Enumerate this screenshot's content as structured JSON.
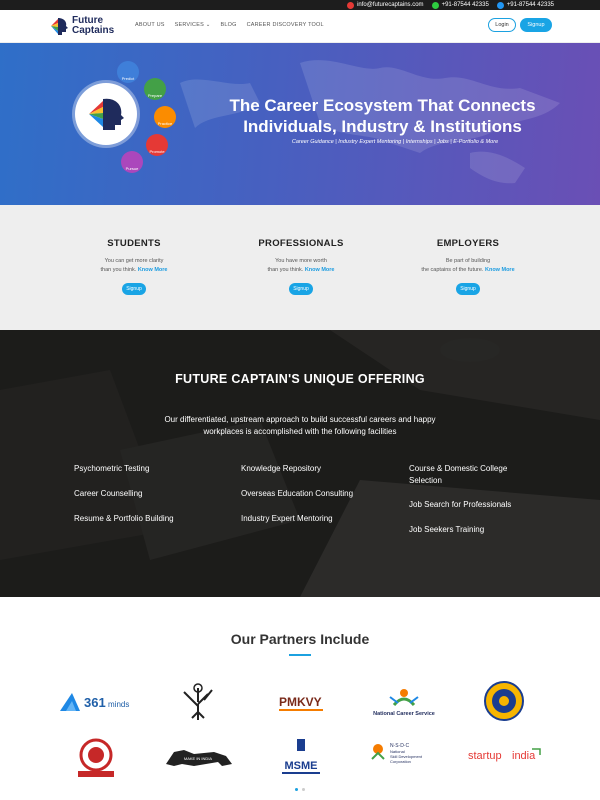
{
  "topbar": {
    "email": "info@futurecaptains.com",
    "whatsapp": "+91-87544 42335",
    "phone": "+91-87544 42335"
  },
  "brand": {
    "name_line1": "Future",
    "name_line2": "Captains"
  },
  "nav": {
    "items": [
      "ABOUT US",
      "SERVICES",
      "BLOG",
      "CAREER DISCOVERY TOOL"
    ],
    "login": "Login",
    "signup": "Signup"
  },
  "hero": {
    "title_line1": "The Career Ecosystem That Connects",
    "title_line2": "Individuals, Industry & Institutions",
    "subtitle": "Career Guidance | Industry Expert Mentoring | Internships | Jobs | E-Portfolio & More",
    "bubbles": [
      "Predict",
      "Prepare",
      "Practice",
      "Promote",
      "Pursue"
    ]
  },
  "audience": [
    {
      "title": "STUDENTS",
      "line1": "You can get more clarity",
      "line2": "than you think.",
      "link": "Know More",
      "button": "Signup"
    },
    {
      "title": "PROFESSIONALS",
      "line1": "You have more worth",
      "line2": "than you think.",
      "link": "Know More",
      "button": "Signup"
    },
    {
      "title": "EMPLOYERS",
      "line1": "Be part of building",
      "line2": "the captains of the future.",
      "link": "Know More",
      "button": "Signup"
    }
  ],
  "offering": {
    "title": "FUTURE CAPTAIN'S UNIQUE OFFERING",
    "subtitle_line1": "Our differentiated, upstream approach to build successful careers and happy",
    "subtitle_line2": "workplaces is accomplished with the following facilities",
    "col1": [
      "Psychometric Testing",
      "Career Counselling",
      "Resume & Portfolio Building"
    ],
    "col2": [
      "Knowledge Repository",
      "Overseas Education Consulting",
      "Industry Expert Mentoring"
    ],
    "col3a_line1": "Course & Domestic College",
    "col3a_line2": "Selection",
    "col3": [
      "Job Search for Professionals",
      "Job Seekers Training"
    ]
  },
  "partners": {
    "title": "Our Partners Include",
    "logos": {
      "l361": "361",
      "l361b": "minds",
      "pmkvy": "PMKVY",
      "ncs": "National Career Service",
      "mii": "MAKE IN INDIA",
      "msme": "MSME",
      "nsdc1": "N·S·D·C",
      "nsdc2": "National",
      "nsdc3": "Skill Development",
      "nsdc4": "Corporation",
      "startup1": "startup",
      "startup2": "india"
    }
  },
  "colors": {
    "accent": "#19a4e5",
    "brand_navy": "#1f2b5c",
    "hero_start": "#2f6fc8",
    "hero_end": "#6a4fb5"
  }
}
